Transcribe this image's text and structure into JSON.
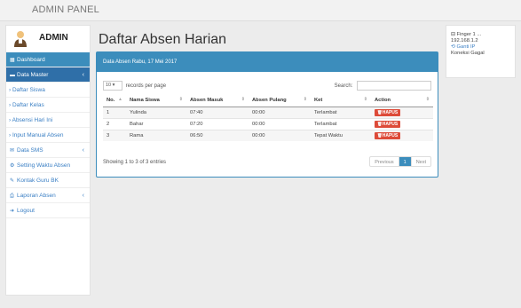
{
  "header": {
    "brand": "ADMIN PANEL"
  },
  "sidebar": {
    "admin_label": "ADMIN",
    "items": [
      {
        "label": "Dashboard",
        "icon": "dashboard-icon",
        "glyph": "▦",
        "chev": ""
      },
      {
        "label": "Data Master",
        "icon": "folder-icon",
        "glyph": "▬",
        "chev": "‹"
      },
      {
        "label": "› Daftar Siswa",
        "chev": ""
      },
      {
        "label": "› Daftar Kelas",
        "chev": ""
      },
      {
        "label": "› Absensi Hari Ini",
        "chev": ""
      },
      {
        "label": "› Input Manual Absen",
        "chev": ""
      },
      {
        "label": "Data SMS",
        "icon": "sms-icon",
        "glyph": "✉",
        "chev": "‹"
      },
      {
        "label": "Setting Waktu Absen",
        "icon": "gears-icon",
        "glyph": "⚙",
        "chev": ""
      },
      {
        "label": "Kontak Guru BK",
        "icon": "edit-icon",
        "glyph": "✎",
        "chev": ""
      },
      {
        "label": "Laporan Absen",
        "icon": "print-icon",
        "glyph": "⎙",
        "chev": "‹"
      },
      {
        "label": "Logout",
        "icon": "logout-icon",
        "glyph": "➜",
        "chev": ""
      }
    ]
  },
  "main": {
    "title": "Daftar Absen Harian",
    "panel_header": "Data Absen Rabu, 17 Mei 2017",
    "length_value": "10",
    "length_suffix": "records per page",
    "search_label": "Search:",
    "search_value": "",
    "columns": [
      "No.",
      "Nama Siswa",
      "Absen Masuk",
      "Absen Pulang",
      "Ket",
      "Action"
    ],
    "rows": [
      {
        "no": "1",
        "nama": "Yulinda",
        "masuk": "07:40",
        "pulang": "00:00",
        "ket": "Terlambat",
        "action": "HAPUS"
      },
      {
        "no": "2",
        "nama": "Bahar",
        "masuk": "07:20",
        "pulang": "00:00",
        "ket": "Terlambat",
        "action": "HAPUS"
      },
      {
        "no": "3",
        "nama": "Rama",
        "masuk": "06:50",
        "pulang": "00:00",
        "ket": "Tepat Waktu",
        "action": "HAPUS"
      }
    ],
    "info": "Showing 1 to 3 of 3 entries",
    "pager": {
      "prev": "Previous",
      "current": "1",
      "next": "Next"
    }
  },
  "right_panel": {
    "finger_label": "Finger 1",
    "finger_suffix": "...",
    "ip": "192.168.1.2",
    "change_ip": "Ganti IP",
    "status": "Koneksi Gagal"
  },
  "colors": {
    "accent": "#3c8dbc",
    "danger": "#dd4b39",
    "link": "#3a7fc4"
  }
}
